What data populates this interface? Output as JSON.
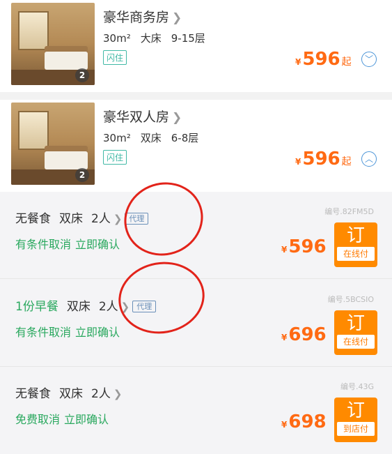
{
  "rooms": [
    {
      "name": "豪华商务房",
      "area": "30m²",
      "bed": "大床",
      "floor": "9-15层",
      "tag": "闪住",
      "photo_count": "2",
      "price_symbol": "¥",
      "price": "596",
      "price_suffix": "起",
      "toggle_icon": "chevron-down-icon"
    },
    {
      "name": "豪华双人房",
      "area": "30m²",
      "bed": "双床",
      "floor": "6-8层",
      "tag": "闪住",
      "photo_count": "2",
      "price_symbol": "¥",
      "price": "596",
      "price_suffix": "起",
      "toggle_icon": "chevron-up-icon"
    }
  ],
  "plans": [
    {
      "meal": "无餐食",
      "bed": "双床",
      "guests": "2人",
      "agent_tag": "代理",
      "cancel": "有条件取消",
      "confirm": "立即确认",
      "code": "编号.82FM5D",
      "price_symbol": "¥",
      "price": "596",
      "book_label": "订",
      "pay_label": "在线付"
    },
    {
      "meal": "1份早餐",
      "bed": "双床",
      "guests": "2人",
      "agent_tag": "代理",
      "cancel": "有条件取消",
      "confirm": "立即确认",
      "code": "编号.5BCSIO",
      "price_symbol": "¥",
      "price": "696",
      "book_label": "订",
      "pay_label": "在线付"
    },
    {
      "meal": "无餐食",
      "bed": "双床",
      "guests": "2人",
      "cancel": "免费取消",
      "confirm": "立即确认",
      "code": "编号.43G",
      "price_symbol": "¥",
      "price": "698",
      "book_label": "订",
      "pay_label": "到店付"
    }
  ],
  "colors": {
    "price": "#ff6a13",
    "book_button": "#ff8a00",
    "green_text": "#29a85e",
    "annotation": "#e2231a"
  }
}
